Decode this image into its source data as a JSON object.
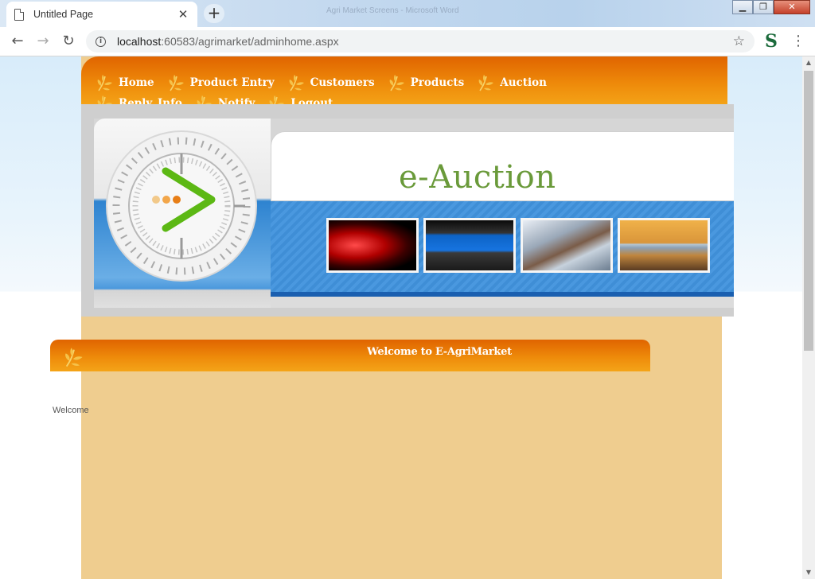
{
  "browser": {
    "tab_title": "Untitled Page",
    "tab_close": "✕",
    "new_tab": "+",
    "window_title": "Agri Market Screens - Microsoft Word",
    "url_host": "localhost",
    "url_rest": ":60583/agrimarket/adminhome.aspx"
  },
  "menu": {
    "items": [
      {
        "label": "Home"
      },
      {
        "label": "Product Entry"
      },
      {
        "label": "Customers"
      },
      {
        "label": "Products"
      },
      {
        "label": "Auction"
      },
      {
        "label": "Reply_Info"
      },
      {
        "label": "Notify"
      },
      {
        "label": "Logout"
      }
    ]
  },
  "banner": {
    "title": "e-Auction"
  },
  "welcome": {
    "heading": "Welcome to E-AgriMarket",
    "text": "Welcome"
  },
  "colors": {
    "menu_orange": "#ee8a0a",
    "content_tan": "#efcd8f",
    "title_green": "#6a9a3a"
  }
}
